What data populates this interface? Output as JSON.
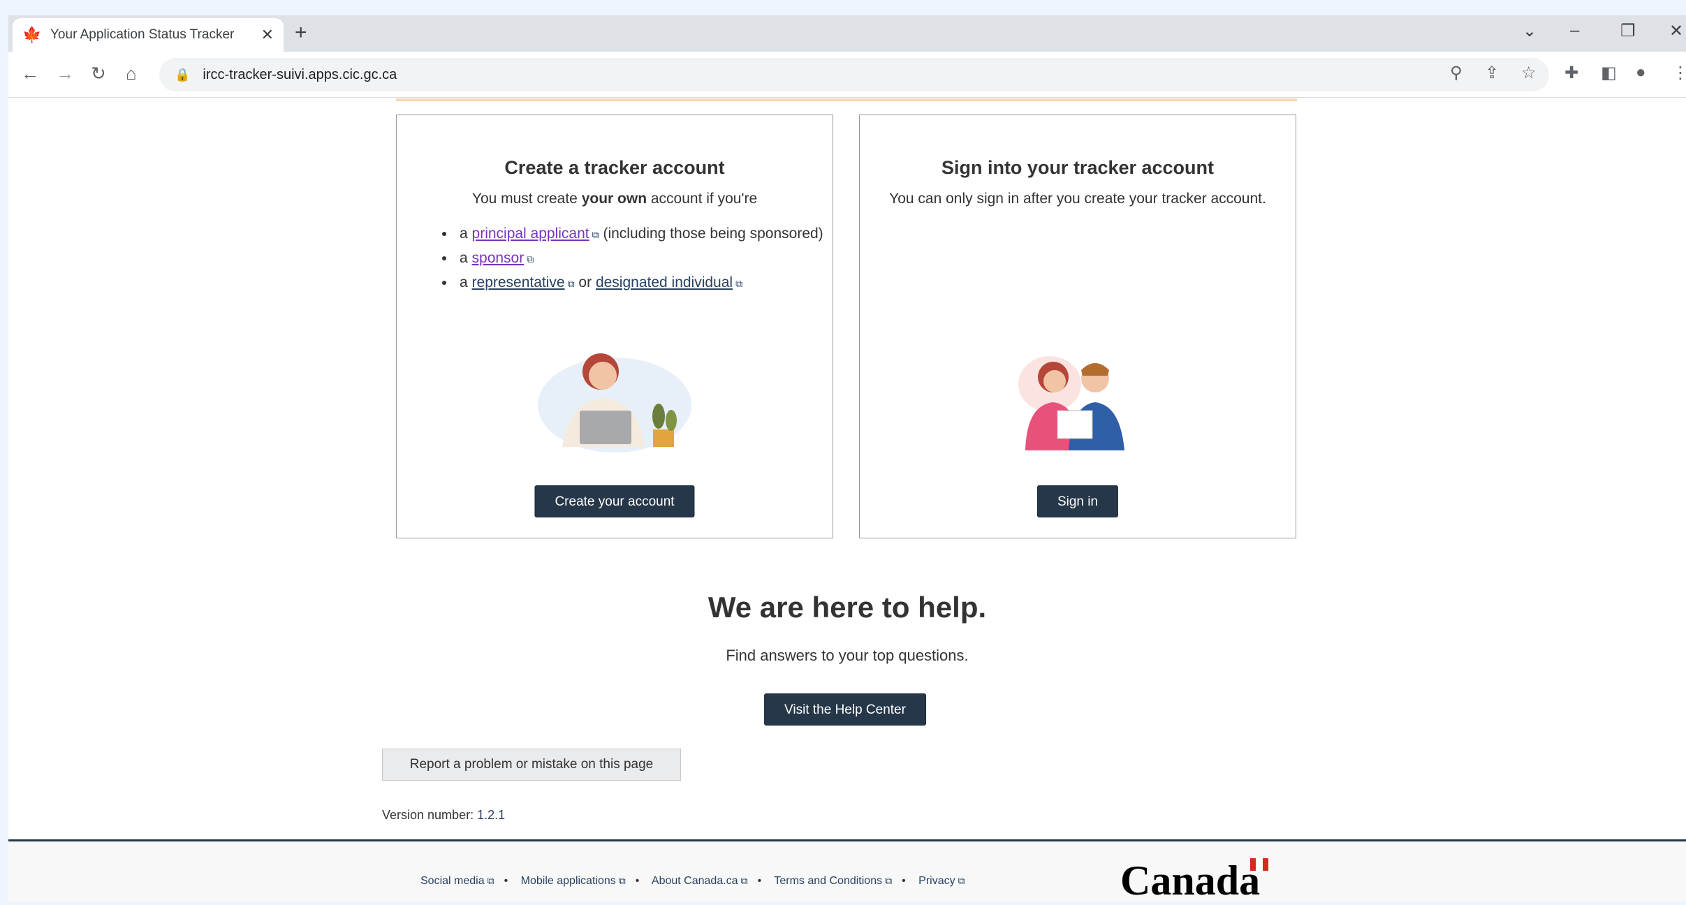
{
  "browser": {
    "tab_title": "Your Application Status Tracker",
    "url": "ircc-tracker-suivi.apps.cic.gc.ca"
  },
  "create_card": {
    "title": "Create a tracker account",
    "intro_prefix": "You must create ",
    "intro_bold": "your own",
    "intro_suffix": " account if you're",
    "items": [
      {
        "prefix": "a ",
        "link": "principal applicant",
        "suffix": " (including those being sponsored)"
      },
      {
        "prefix": "a ",
        "link": "sponsor",
        "suffix": ""
      },
      {
        "prefix": "a ",
        "link": "representative",
        "mid": " or ",
        "link2": "designated individual"
      }
    ],
    "button": "Create your account"
  },
  "signin_card": {
    "title": "Sign into your tracker account",
    "text": "You can only sign in after you create your tracker account.",
    "button": "Sign in"
  },
  "help": {
    "title": "We are here to help.",
    "subtitle": "Find answers to your top questions.",
    "button": "Visit the Help Center"
  },
  "report_button": "Report a problem or mistake on this page",
  "version_label": "Version number: ",
  "version_number": "1.2.1",
  "footer": {
    "links": [
      "Social media",
      "Mobile applications",
      "About Canada.ca",
      "Terms and Conditions",
      "Privacy"
    ],
    "wordmark": "Canada"
  }
}
